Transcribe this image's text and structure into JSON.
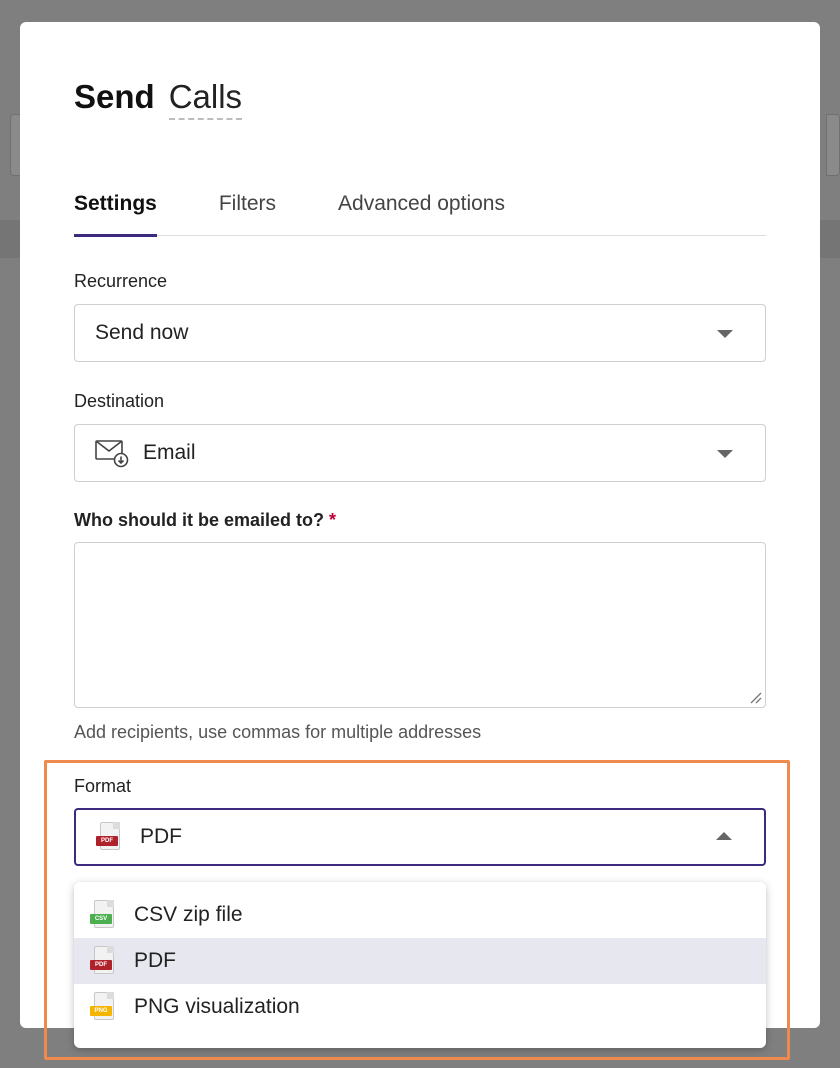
{
  "dialog": {
    "title_static": "Send",
    "title_name": "Calls"
  },
  "tabs": [
    {
      "label": "Settings",
      "active": true
    },
    {
      "label": "Filters",
      "active": false
    },
    {
      "label": "Advanced options",
      "active": false
    }
  ],
  "recurrence": {
    "label": "Recurrence",
    "value": "Send now"
  },
  "destination": {
    "label": "Destination",
    "value": "Email",
    "icon": "email-icon"
  },
  "recipients": {
    "label": "Who should it be emailed to?",
    "required_marker": "*",
    "value": "",
    "hint": "Add recipients, use commas for multiple addresses"
  },
  "format": {
    "label": "Format",
    "value": "PDF",
    "value_tag": "PDF",
    "options": [
      {
        "label": "CSV zip file",
        "tag": "CSV",
        "tag_color": "#4caf50",
        "selected": false
      },
      {
        "label": "PDF",
        "tag": "PDF",
        "tag_color": "#b0222b",
        "selected": true
      },
      {
        "label": "PNG visualization",
        "tag": "PNG",
        "tag_color": "#f4b400",
        "selected": false
      }
    ]
  },
  "colors": {
    "accent": "#3b2a7e",
    "highlight": "#ee8a4e",
    "required": "#c0003a",
    "pdf": "#b0222b"
  }
}
